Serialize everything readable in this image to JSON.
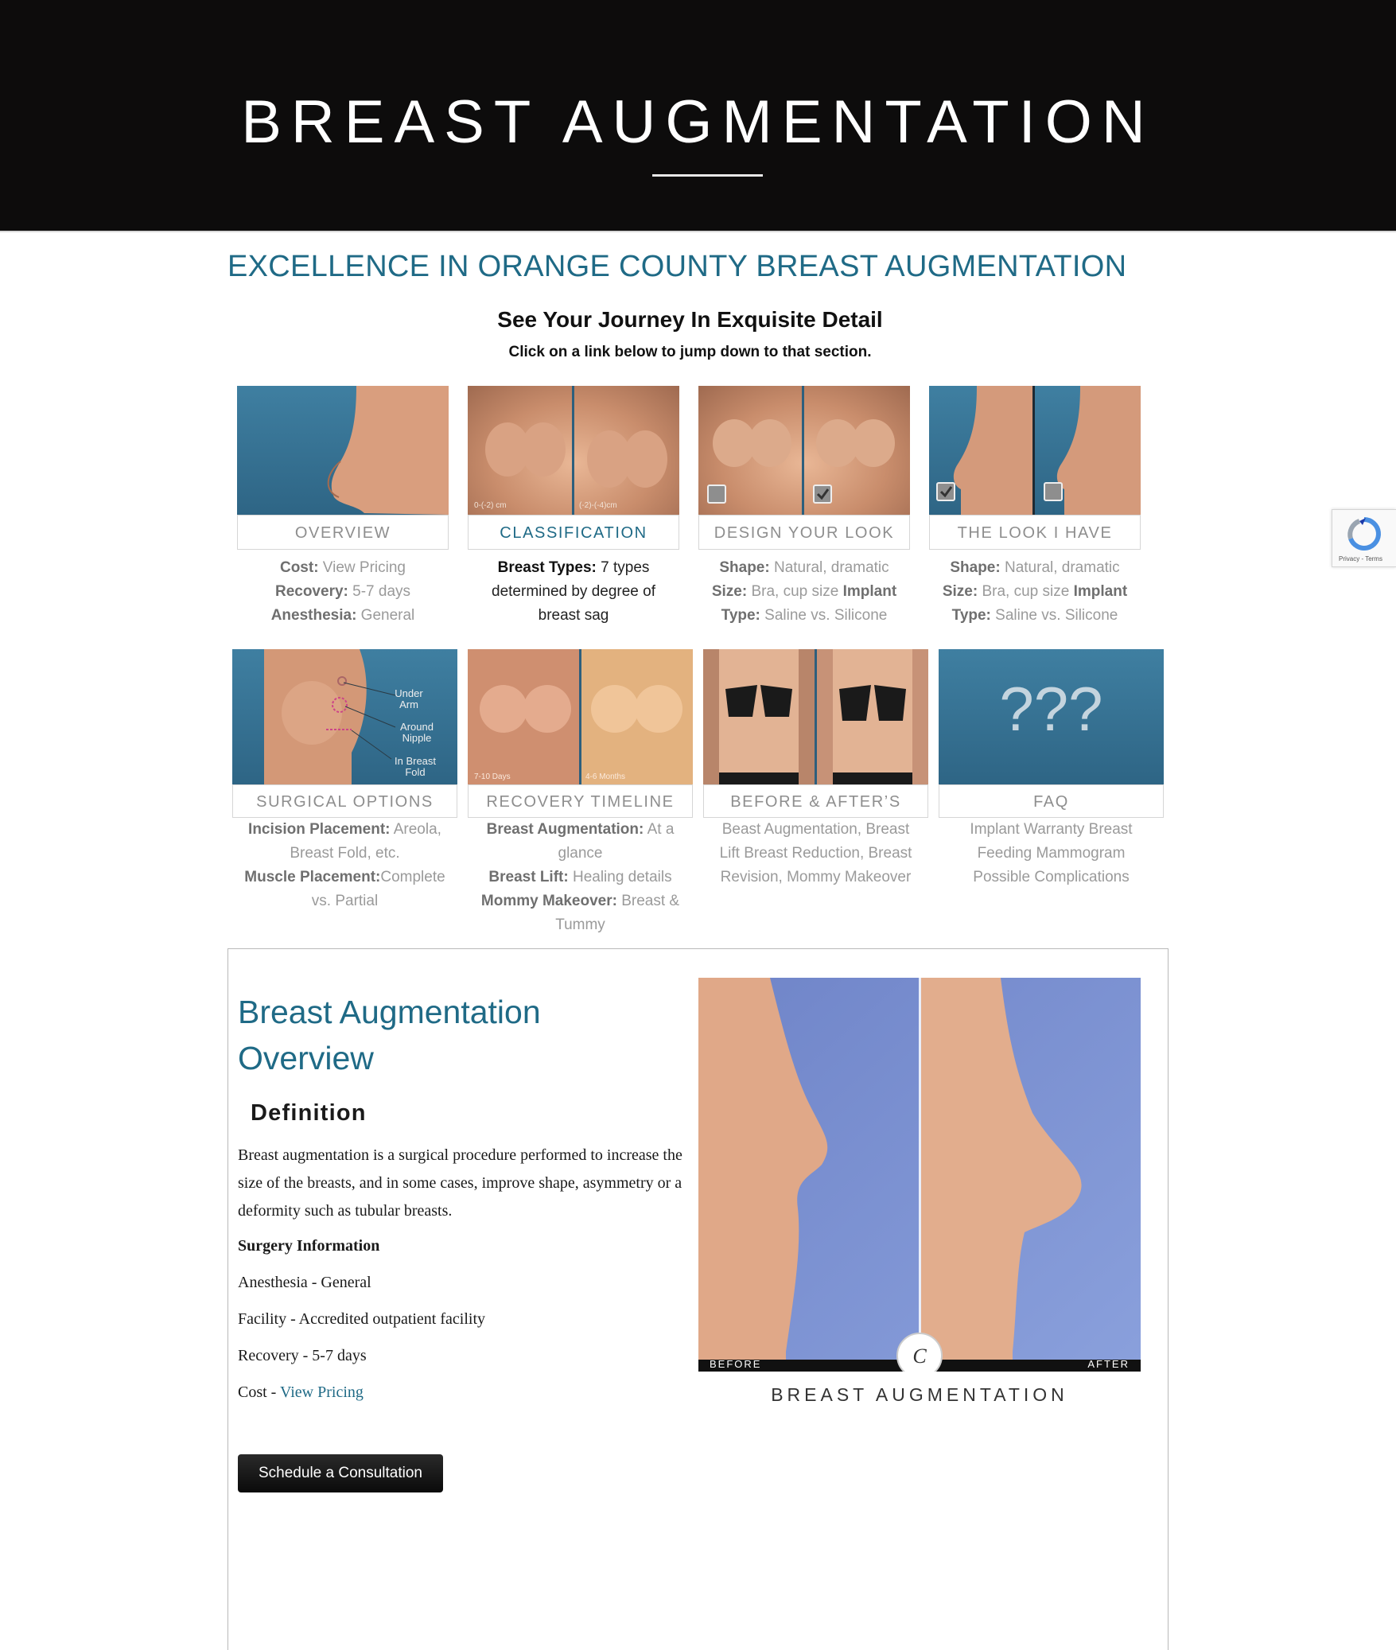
{
  "hero": {
    "title": "BREAST AUGMENTATION"
  },
  "intro": {
    "heading": "EXCELLENCE IN ORANGE COUNTY BREAST AUGMENTATION",
    "journey_title": "See Your Journey In Exquisite Detail",
    "journey_subtitle": "Click on a link below to jump down to that section."
  },
  "cards_row1": [
    {
      "label": "OVERVIEW",
      "lines": [
        [
          "Cost:",
          " View Pricing"
        ],
        [
          "Recovery:",
          " 5-7 days"
        ],
        [
          "Anesthesia:",
          " General"
        ]
      ]
    },
    {
      "label": "CLASSIFICATION",
      "photo_left_caption": "0-(-2) cm",
      "photo_right_caption": "(-2)-(-4)cm",
      "lines": [
        [
          "Breast Types:",
          " 7 types"
        ],
        [
          "",
          "determined by degree of"
        ],
        [
          "",
          "breast sag"
        ]
      ]
    },
    {
      "label": "DESIGN YOUR LOOK",
      "lines": [
        [
          "Shape:",
          " Natural, dramatic"
        ],
        [
          "Size:",
          " Bra, cup size ",
          "Implant"
        ],
        [
          "Type:",
          " Saline vs. Silicone"
        ]
      ]
    },
    {
      "label": "THE LOOK I HAVE",
      "lines": [
        [
          "Shape:",
          " Natural, dramatic"
        ],
        [
          "Size:",
          " Bra, cup size ",
          "Implant"
        ],
        [
          "Type:",
          " Saline vs. Silicone"
        ]
      ]
    }
  ],
  "cards_row2": [
    {
      "label": "SURGICAL OPTIONS",
      "annotations": [
        "Under\nArm",
        "Around\nNipple",
        "In Breast\nFold"
      ],
      "lines": [
        [
          "Incision Placement:",
          " Areola,"
        ],
        [
          "",
          "Breast Fold, etc."
        ],
        [
          "Muscle Placement:",
          "Complete"
        ],
        [
          "",
          "vs. Partial"
        ]
      ]
    },
    {
      "label": "RECOVERY TIMELINE",
      "photo_left_caption": "7-10 Days",
      "photo_right_caption": "4-6 Months",
      "lines": [
        [
          "Breast Augmentation:",
          " At a"
        ],
        [
          "",
          "glance"
        ],
        [
          "Breast Lift:",
          " Healing details"
        ],
        [
          "Mommy Makeover:",
          " Breast &"
        ],
        [
          "",
          "Tummy"
        ]
      ]
    },
    {
      "label": "BEFORE & AFTER’S",
      "lines": [
        [
          "",
          "Beast Augmentation, Breast"
        ],
        [
          "",
          "Lift Breast Reduction, Breast"
        ],
        [
          "",
          "Revision, Mommy Makeover"
        ]
      ]
    },
    {
      "label": "FAQ",
      "photo_text": "???",
      "lines": [
        [
          "",
          "Implant Warranty Breast"
        ],
        [
          "",
          "Feeding Mammogram"
        ],
        [
          "",
          "Possible Complications"
        ]
      ]
    }
  ],
  "overview": {
    "title": "Breast Augmentation Overview",
    "definition_heading": "Definition",
    "definition_text": "Breast augmentation is a surgical procedure performed to increase the size of the breasts, and in some cases, improve shape, asymmetry or a deformity such as tubular breasts.",
    "surgery_info_heading": "Surgery Information",
    "anesthesia": "Anesthesia - General",
    "facility": "Facility - Accredited outpatient facility",
    "recovery": "Recovery - 5-7 days",
    "cost_prefix": "Cost - ",
    "cost_link": "View Pricing",
    "cta": "Schedule a Consultation",
    "photo_before": "BEFORE",
    "photo_after": "AFTER",
    "photo_caption": "BREAST AUGMENTATION"
  },
  "recaptcha": {
    "links": "Privacy - Terms"
  }
}
